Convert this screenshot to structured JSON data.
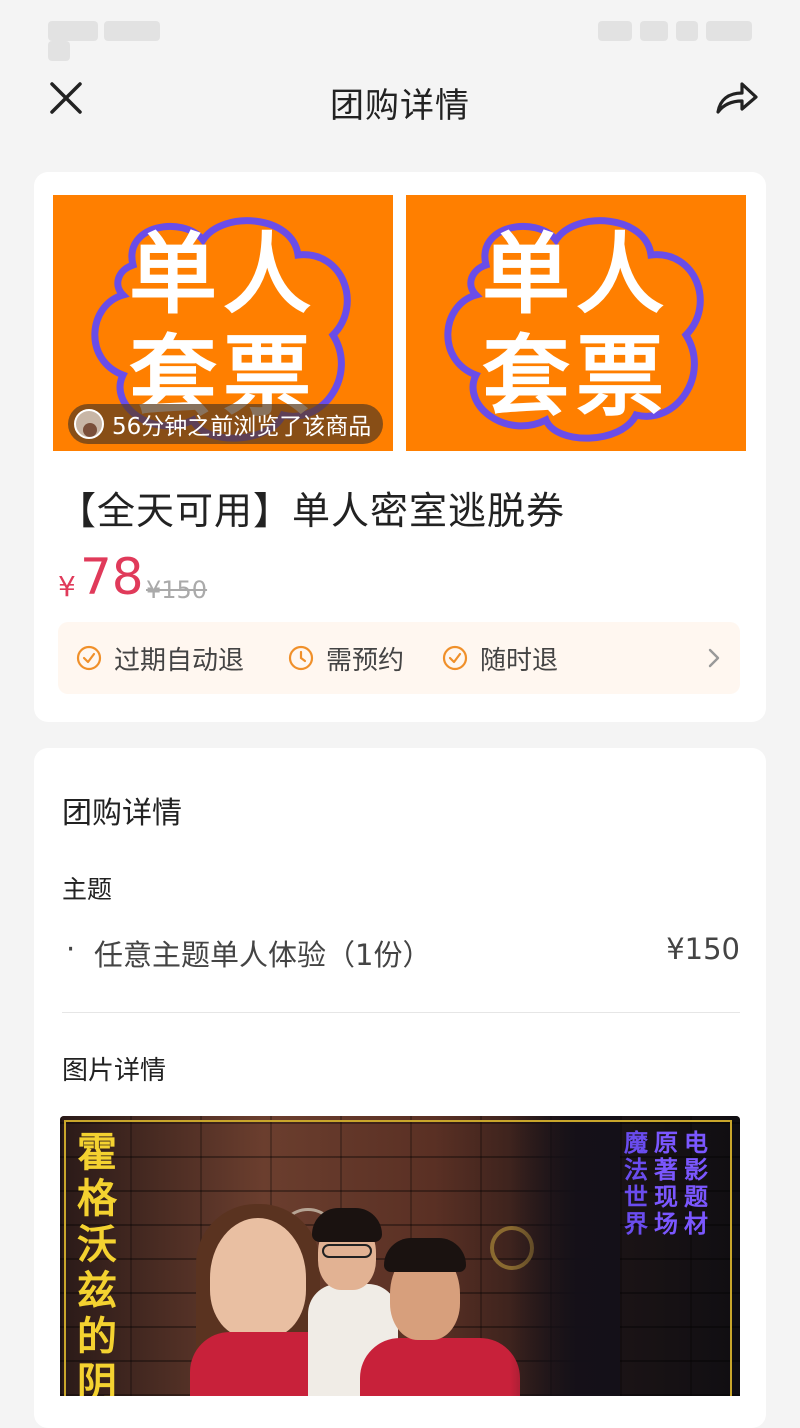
{
  "nav": {
    "title": "团购详情",
    "close_icon": "close-icon",
    "share_icon": "share-icon"
  },
  "product": {
    "poster_line1": "单人",
    "poster_line2": "套票",
    "poster_bg": "#ff7f00",
    "view_badge": "56分钟之前浏览了该商品",
    "title": "【全天可用】单人密室逃脱券",
    "price_currency": "¥",
    "price": "78",
    "original_price": "¥150",
    "price_color": "#e03a5a",
    "tags": [
      {
        "icon": "check-circle-icon",
        "label": "过期自动退"
      },
      {
        "icon": "clock-icon",
        "label": "需预约"
      },
      {
        "icon": "check-circle-icon",
        "label": "随时退"
      }
    ]
  },
  "details": {
    "section_title": "团购详情",
    "subsection_title": "主题",
    "item": {
      "bullet": "·",
      "name": "任意主题单人体验（1份）",
      "price": "¥150"
    },
    "pictures_title": "图片详情",
    "movie_title": "霍格沃兹的阴",
    "movie_tags": [
      "电影题材",
      "原著现场",
      "魔法世界"
    ]
  }
}
